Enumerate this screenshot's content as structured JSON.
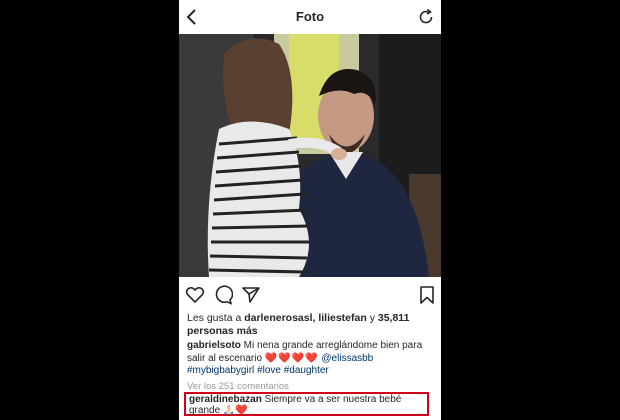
{
  "header": {
    "title": "Foto"
  },
  "photo": {
    "description_icon": "photo-image"
  },
  "actions": {
    "like_icon": "heart-outline-icon",
    "comment_icon": "speech-bubble-icon",
    "share_icon": "paper-plane-icon",
    "save_icon": "bookmark-icon"
  },
  "likes": {
    "prefix": "Les gusta a ",
    "users": "darlenerosasl, liliestefan",
    "connector": " y ",
    "count": "35,811",
    "suffix": "personas más"
  },
  "caption": {
    "username": "gabrielsoto",
    "text": " Mi nena grande arreglándome bien para salir al escenario ",
    "hearts": "❤️❤️❤️❤️",
    "mention": "@elissasbb",
    "hashtags": "#mybigbabygirl #love #daughter"
  },
  "comments": {
    "view_all": "Ver los 251 comentarios"
  },
  "highlighted_comment": {
    "username": "geraldinebazan",
    "text": " Siempre va a ser nuestra bebé grande ",
    "emoji": "🙏🏻❤️"
  },
  "colors": {
    "highlight_border": "#d0021b",
    "link": "#003569",
    "muted": "#999999"
  }
}
